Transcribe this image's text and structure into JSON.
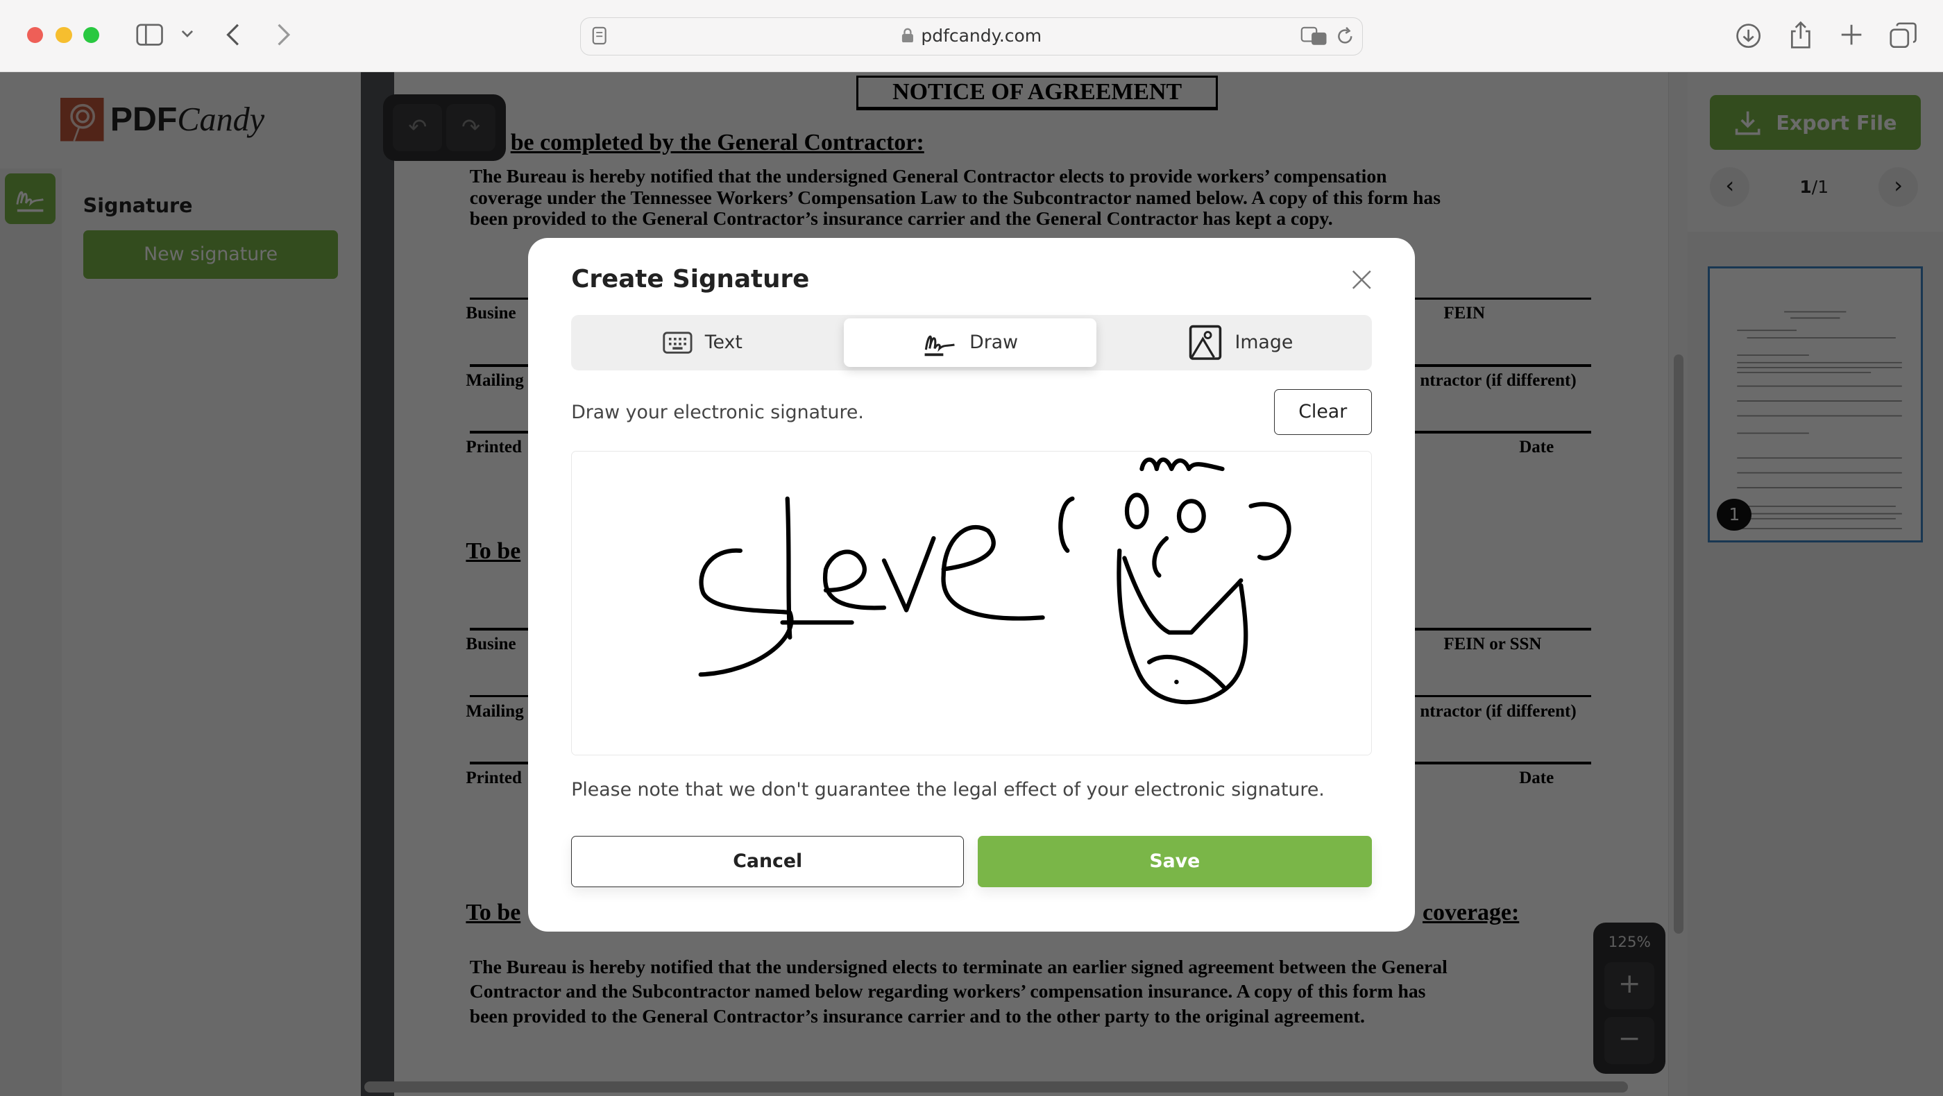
{
  "browser": {
    "url": "pdfcandy.com",
    "icons": [
      "sidebar-icon",
      "chevron-down-icon",
      "back-icon",
      "forward-icon",
      "reader-icon",
      "lock-icon",
      "translate-icon",
      "reload-icon",
      "download-icon",
      "share-icon",
      "new-tab-icon",
      "tabs-overview-icon"
    ]
  },
  "app": {
    "logo": {
      "text_a": "PDF",
      "text_b": "Candy"
    },
    "sidebar": {
      "section_title": "Signature",
      "new_signature": "New signature"
    },
    "export_label": "Export File",
    "pager": {
      "current": "1",
      "total": "/1"
    },
    "thumbnail_badge": "1",
    "zoom": {
      "level": "125%",
      "plus": "+",
      "minus": "−"
    }
  },
  "document": {
    "title": "NOTICE OF AGREEMENT",
    "heading1": "be completed by the General Contractor:",
    "para1": [
      "The Bureau is hereby notified that the undersigned General Contractor elects to provide workers’ compensation",
      "coverage under the Tennessee Workers’ Compensation Law to the Subcontractor named below.  A copy of this form has",
      "been provided to the General Contractor’s insurance carrier and the General Contractor has kept a copy."
    ],
    "fields": [
      "Busine",
      "FEIN",
      "Mailing",
      "ntractor (if different)",
      "Printed",
      "Date",
      "To be",
      "Busine",
      "FEIN or SSN",
      "Mailing",
      "ntractor (if different)",
      "Printed",
      "Date",
      "To be",
      "coverage:"
    ],
    "para2": [
      "The Bureau is hereby notified that the undersigned elects to terminate an earlier signed agreement between the General",
      "Contractor and the Subcontractor named below regarding workers’ compensation insurance.  A copy of this form has",
      "been provided to the General Contractor’s insurance carrier and to the other party to the original agreement."
    ]
  },
  "modal": {
    "title": "Create Signature",
    "tabs": [
      {
        "label": "Text",
        "icon": "keyboard-icon"
      },
      {
        "label": "Draw",
        "icon": "signature-icon",
        "active": true
      },
      {
        "label": "Image",
        "icon": "image-icon"
      }
    ],
    "instruction": "Draw your electronic signature.",
    "clear": "Clear",
    "note": "Please note that we don't guarantee the legal effect of your electronic signature.",
    "cancel": "Cancel",
    "save": "Save"
  },
  "colors": {
    "brand_green": "#7ab648",
    "logo_red": "#c2553a",
    "thumb_border": "#3b82c4"
  }
}
